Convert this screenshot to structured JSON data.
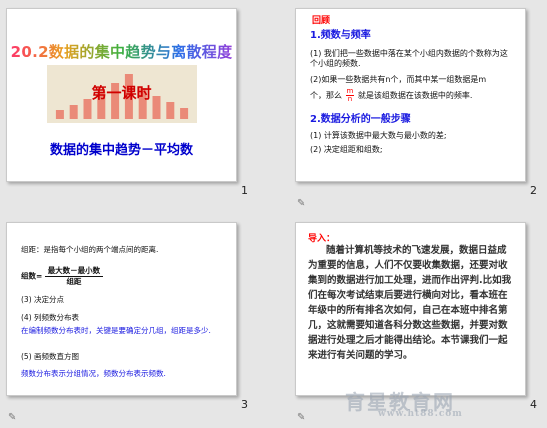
{
  "colors": {
    "background": "#e6e6e6",
    "slide1_title_gradient": [
      "#ff2f6d",
      "#e8a020",
      "#3cb040",
      "#2c6fe8",
      "#9a3cd8"
    ],
    "slide1_lesson": "#d00000",
    "slide1_subtitle": "#0000cc",
    "slide1_chart_bars": "#ea8a78",
    "accent_red": "#ff0000",
    "accent_blue": "#1a1ae0",
    "note_icon": "#777777"
  },
  "slides": [
    {
      "number": "1",
      "title": "20.2数据的集中趋势与离散程度",
      "lesson": "第一课时",
      "subtitle": "数据的集中趋势－平均数",
      "chart_bar_levels": [
        0.18,
        0.28,
        0.4,
        0.55,
        0.72,
        0.9,
        0.62,
        0.46,
        0.34,
        0.22
      ]
    },
    {
      "number": "2",
      "heading": "回顾",
      "section1": "1.频数与频率",
      "item1": "(1) 我们把一些数据中落在某个小组内数据的个数称为这个小组的频数.",
      "item2_a": "(2)如果一些数据共有n个，而其中某一组数据是m",
      "item2_b": "个，那么",
      "item2_frac_num": "m",
      "item2_frac_den": "n",
      "item2_c": "就是该组数据在该数据中的频率.",
      "section2": "2.数据分析的一般步骤",
      "step1": "(1) 计算该数据中最大数与最小数的差;",
      "step2": "(2) 决定组距和组数;"
    },
    {
      "number": "3",
      "line1": "组距：是指每个小组的两个端点间的距离.",
      "formula_label": "组数=",
      "formula_num": "最大数－最小数",
      "formula_den": "组距",
      "step3": "(3) 决定分点",
      "step4": "(4) 列频数分布表",
      "step4_note": "在编制频数分布表时，关键是要确定分几组，组距是多少.",
      "step5": "(5) 画频数直方图",
      "step5_note": "频数分布表示分组情况，频数分布表示频数."
    },
    {
      "number": "4",
      "intro": "导入：",
      "body": "随着计算机等技术的飞速发展，数据日益成为重要的信息，人们不仅要收集数据，还要对收集到的数据进行加工处理，进而作出评判.比如我们在每次考试结束后要进行横向对比，看本班在年级中的所有排名次如何，自己在本班中排名第几，这就需要知道各科分数这些数据，并要对数据进行处理之后才能得出结论。本节课我们一起来进行有关问题的学习。"
    }
  ],
  "watermark": {
    "text": "育星教育网",
    "url": "www.ht88.com"
  }
}
